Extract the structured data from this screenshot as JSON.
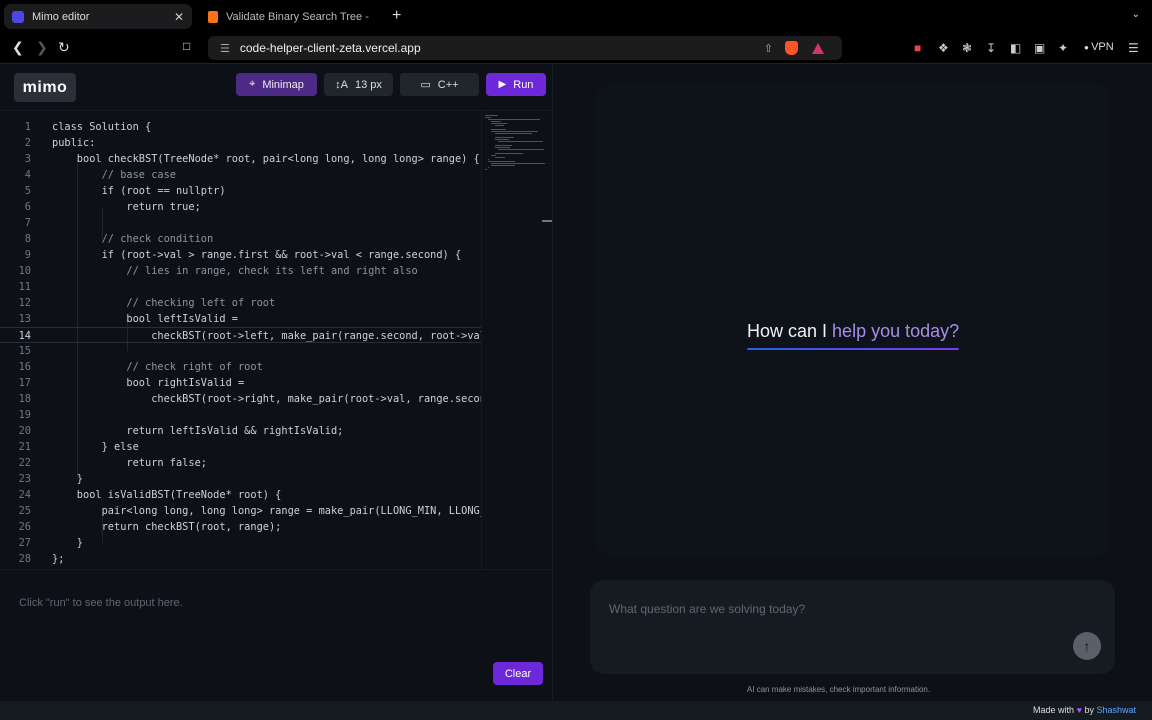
{
  "browser": {
    "tabs": [
      {
        "title": "Mimo editor",
        "close": "✕"
      },
      {
        "title": "Validate Binary Search Tree - Lee"
      }
    ],
    "new_tab": "+",
    "url": "code-helper-client-zeta.vercel.app",
    "vpn_label": "VPN",
    "favicon_color": "#4f46e5",
    "favicon2_color": "#f97316"
  },
  "app": {
    "logo": "mimo",
    "toolbar": {
      "minimap_label": "Minimap",
      "font_label": "13 px",
      "lang_label": "C++",
      "run_label": "Run"
    },
    "code_lines": [
      {
        "n": "1",
        "t": "class Solution {"
      },
      {
        "n": "2",
        "t": "public:"
      },
      {
        "n": "3",
        "t": "    bool checkBST(TreeNode* root, pair<long long, long long> range) {"
      },
      {
        "n": "4",
        "t": "        // base case",
        "comment": true
      },
      {
        "n": "5",
        "t": "        if (root == nullptr)"
      },
      {
        "n": "6",
        "t": "            return true;"
      },
      {
        "n": "7",
        "t": ""
      },
      {
        "n": "8",
        "t": "        // check condition",
        "comment": true
      },
      {
        "n": "9",
        "t": "        if (root->val > range.first && root->val < range.second) {"
      },
      {
        "n": "10",
        "t": "            // lies in range, check its left and right also",
        "comment": true
      },
      {
        "n": "11",
        "t": ""
      },
      {
        "n": "12",
        "t": "            // checking left of root",
        "comment": true
      },
      {
        "n": "13",
        "t": "            bool leftIsValid ="
      },
      {
        "n": "14",
        "t": "                checkBST(root->left, make_pair(range.second, root->val));",
        "current": true
      },
      {
        "n": "15",
        "t": ""
      },
      {
        "n": "16",
        "t": "            // check right of root",
        "comment": true
      },
      {
        "n": "17",
        "t": "            bool rightIsValid ="
      },
      {
        "n": "18",
        "t": "                checkBST(root->right, make_pair(root->val, range.second));"
      },
      {
        "n": "19",
        "t": ""
      },
      {
        "n": "20",
        "t": "            return leftIsValid && rightIsValid;"
      },
      {
        "n": "21",
        "t": "        } else"
      },
      {
        "n": "22",
        "t": "            return false;"
      },
      {
        "n": "23",
        "t": "    }"
      },
      {
        "n": "24",
        "t": "    bool isValidBST(TreeNode* root) {"
      },
      {
        "n": "25",
        "t": "        pair<long long, long long> range = make_pair(LLONG_MIN, LLONG_MAX);"
      },
      {
        "n": "26",
        "t": "        return checkBST(root, range);"
      },
      {
        "n": "27",
        "t": "    }"
      },
      {
        "n": "28",
        "t": "};"
      }
    ],
    "output_placeholder": "Click \"run\" to see the output here.",
    "clear_label": "Clear",
    "assistant": {
      "hero_plain1": "How can I ",
      "hero_grad": "help you today?",
      "input_placeholder": "What question are we solving today?",
      "disclaimer": "AI can make mistakes, check important information."
    },
    "footer": {
      "made_with": "Made with",
      "by": "by",
      "author": "Shashwat"
    },
    "colors": {
      "accent": "#6d28d9",
      "minimap_active": "#4c2a86",
      "author_link": "#58a6ff"
    }
  }
}
